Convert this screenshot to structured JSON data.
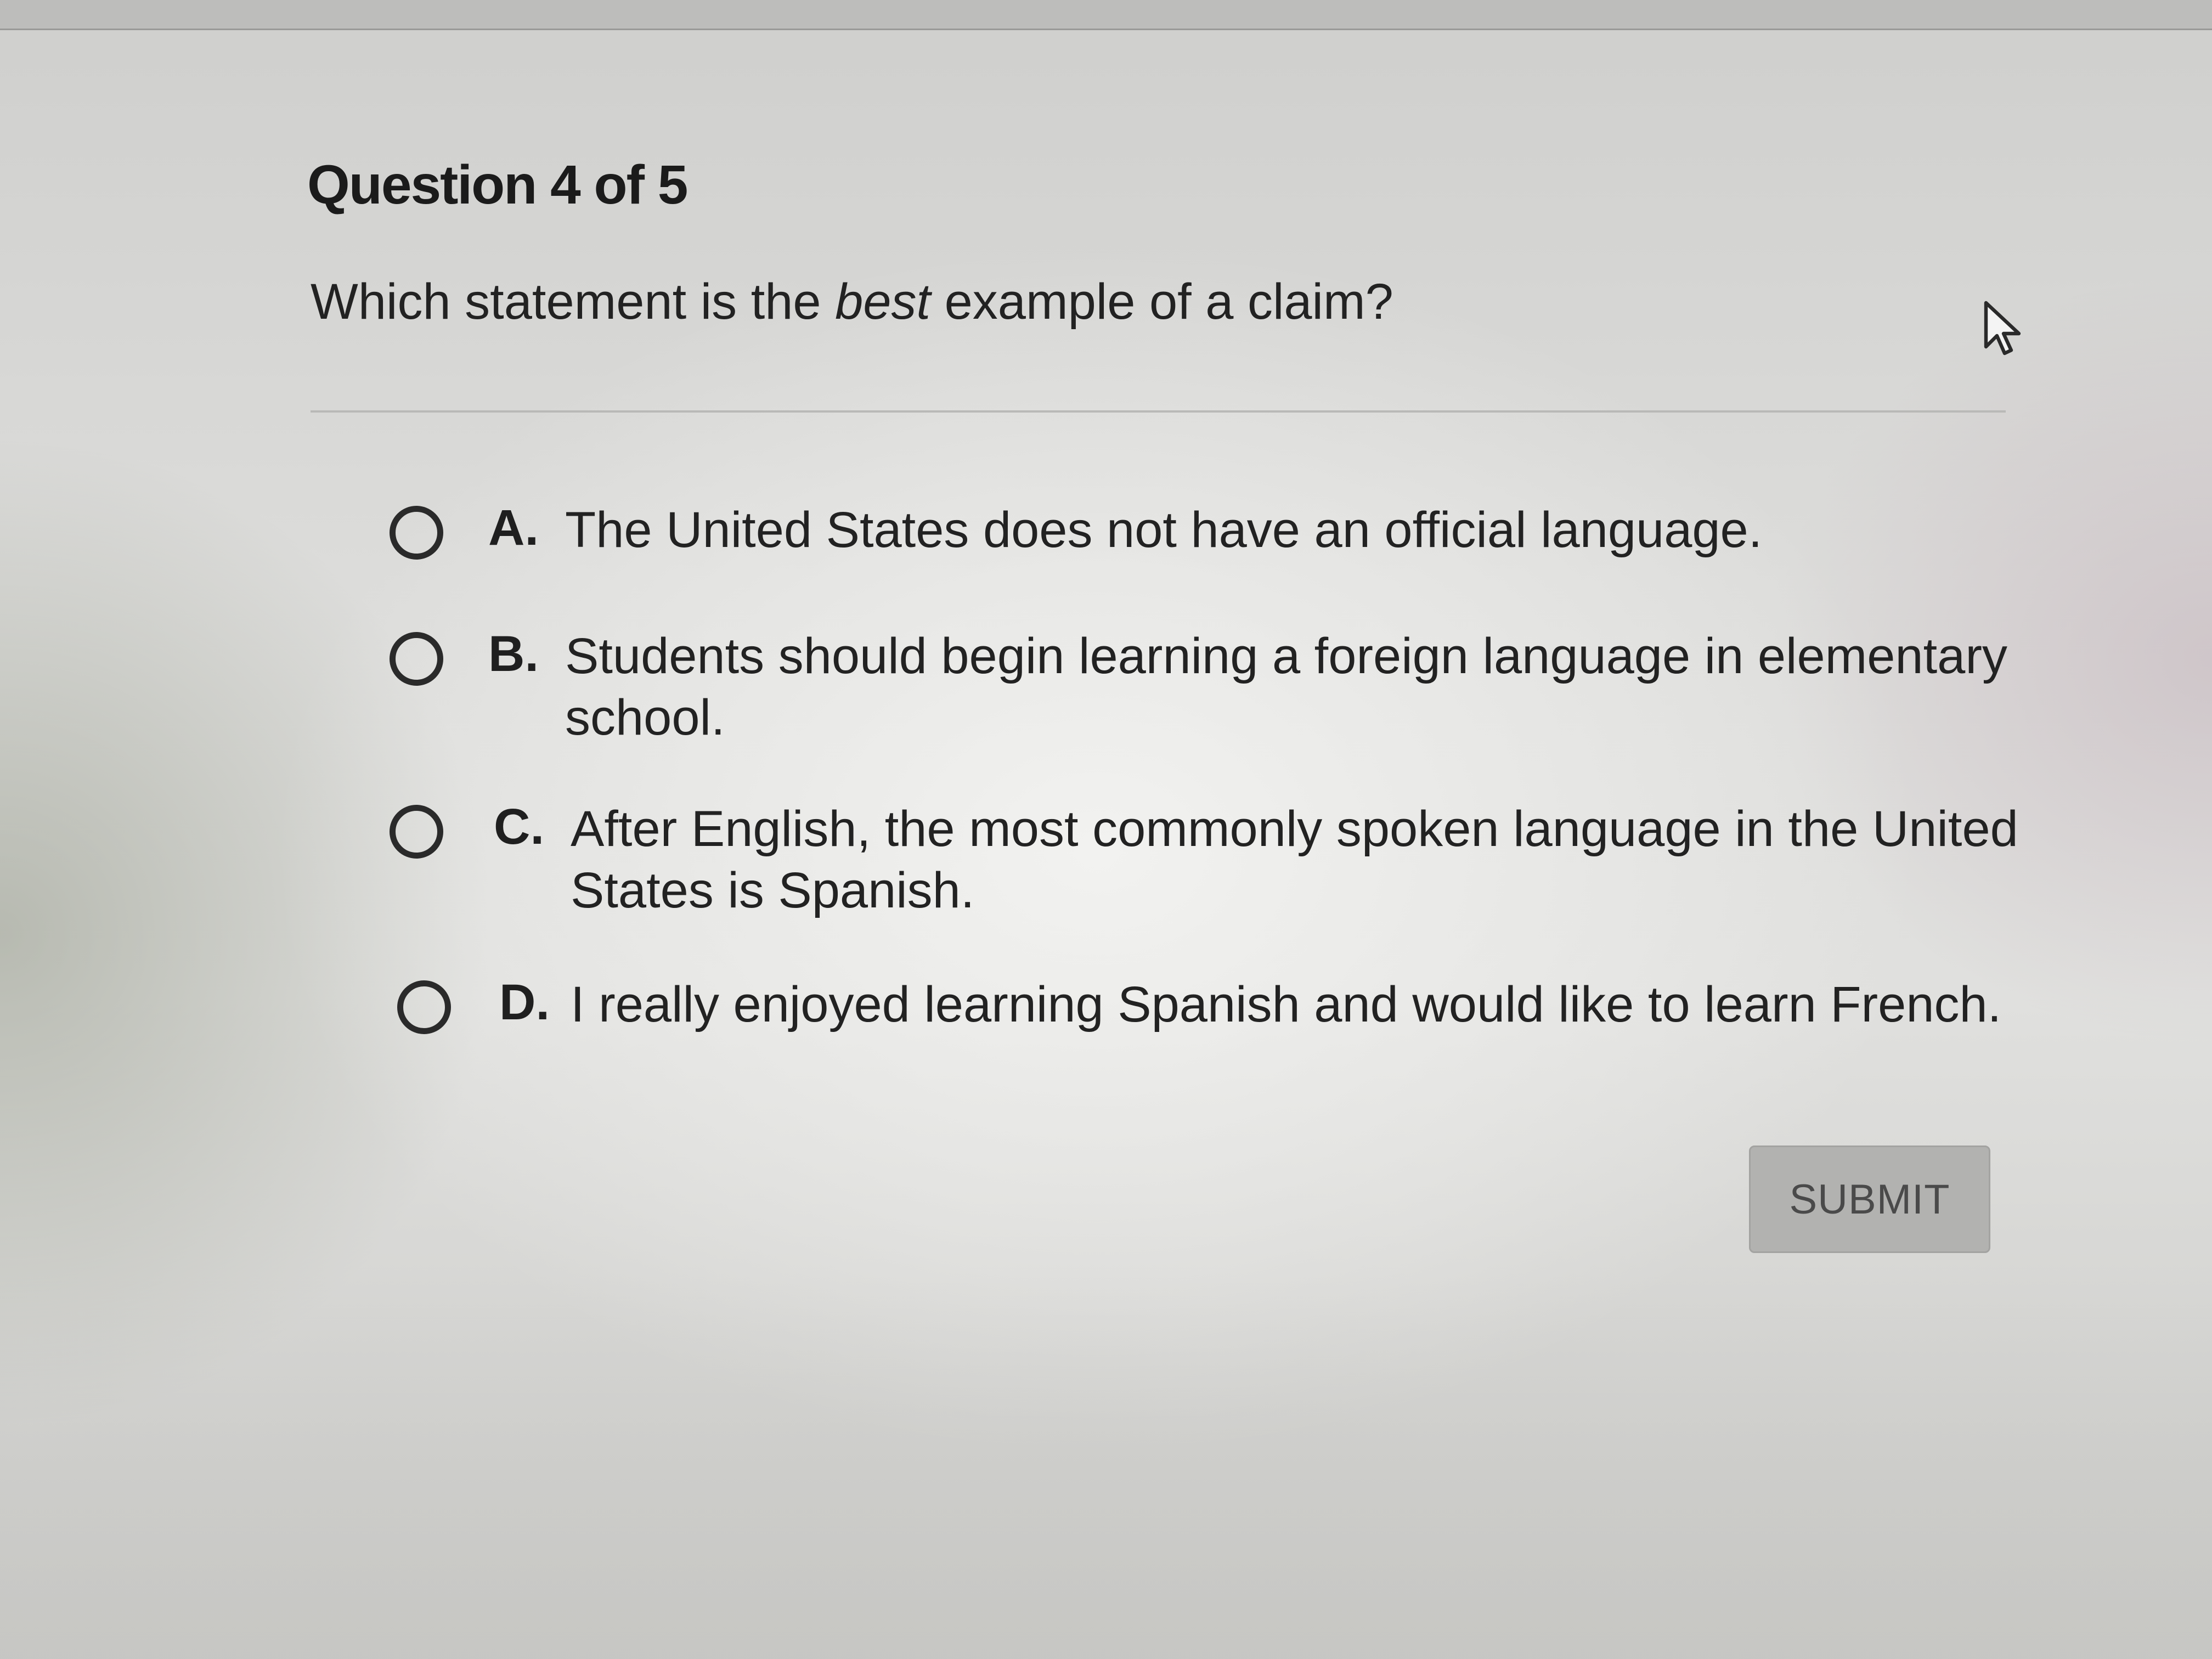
{
  "question": {
    "number_label": "Question 4 of 5",
    "prompt_before": "Which statement is the ",
    "prompt_emphasis": "best",
    "prompt_after": " example of a claim?"
  },
  "options": [
    {
      "letter": "A.",
      "text": "The United States does not have an official language.",
      "selected": false
    },
    {
      "letter": "B.",
      "text": "Students should begin learning a foreign language in elementary school.",
      "selected": false
    },
    {
      "letter": "C.",
      "text": "After English, the most commonly spoken language in the United States is Spanish.",
      "selected": false
    },
    {
      "letter": "D.",
      "text": "I really enjoyed learning Spanish and would like to learn French.",
      "selected": false
    }
  ],
  "submit": {
    "label": "SUBMIT",
    "state": "disabled"
  },
  "cursor": {
    "icon": "arrow-cursor-icon"
  }
}
